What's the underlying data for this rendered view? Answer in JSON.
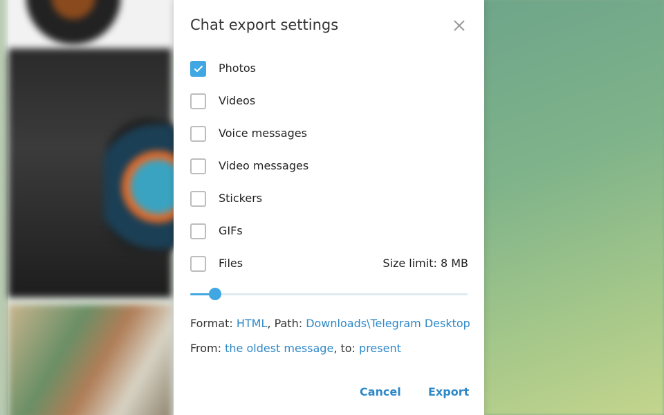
{
  "dialog": {
    "title": "Chat export settings",
    "options": [
      {
        "label": "Photos",
        "checked": true
      },
      {
        "label": "Videos",
        "checked": false
      },
      {
        "label": "Voice messages",
        "checked": false
      },
      {
        "label": "Video messages",
        "checked": false
      },
      {
        "label": "Stickers",
        "checked": false
      },
      {
        "label": "GIFs",
        "checked": false
      },
      {
        "label": "Files",
        "checked": false
      }
    ],
    "size_limit": "Size limit: 8 MB",
    "size_slider_fraction": 0.09,
    "format_line": {
      "format_prefix": "Format: ",
      "format_value": "HTML",
      "path_prefix": ", Path: ",
      "path_value": "Downloads\\Telegram Desktop"
    },
    "range_line": {
      "from_prefix": "From: ",
      "from_value": "the oldest message",
      "to_prefix": ", to: ",
      "to_value": "present"
    },
    "cancel_label": "Cancel",
    "export_label": "Export"
  },
  "colors": {
    "accent": "#40a7e3",
    "link": "#2e88c7"
  }
}
